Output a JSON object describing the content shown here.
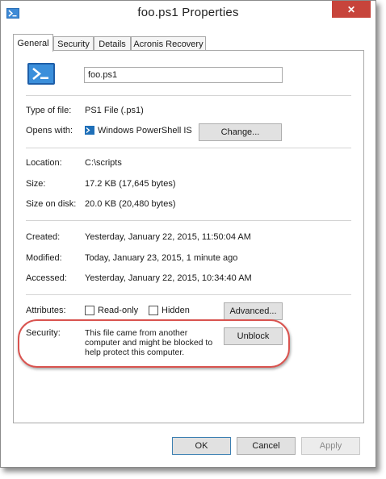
{
  "window": {
    "title": "foo.ps1 Properties",
    "close_glyph": "✕"
  },
  "tabs": [
    {
      "label": "General",
      "active": true
    },
    {
      "label": "Security",
      "active": false
    },
    {
      "label": "Details",
      "active": false
    },
    {
      "label": "Acronis Recovery",
      "active": false
    }
  ],
  "general": {
    "filename": "foo.ps1",
    "type_label": "Type of file:",
    "type_value": "PS1 File (.ps1)",
    "opens_label": "Opens with:",
    "opens_value": "Windows PowerShell IS",
    "change_button": "Change...",
    "location_label": "Location:",
    "location_value": "C:\\scripts",
    "size_label": "Size:",
    "size_value": "17.2 KB (17,645 bytes)",
    "size_disk_label": "Size on disk:",
    "size_disk_value": "20.0 KB (20,480 bytes)",
    "created_label": "Created:",
    "created_value": "Yesterday, January 22, 2015, 11:50:04 AM",
    "modified_label": "Modified:",
    "modified_value": "Today, January 23, 2015, 1 minute ago",
    "accessed_label": "Accessed:",
    "accessed_value": "Yesterday, January 22, 2015, 10:34:40 AM",
    "attributes_label": "Attributes:",
    "readonly_label": "Read-only",
    "hidden_label": "Hidden",
    "advanced_button": "Advanced...",
    "security_label": "Security:",
    "security_text_line1": "This file came from another",
    "security_text_line2": "computer and might be blocked to",
    "security_text_line3": "help protect this computer.",
    "unblock_button": "Unblock"
  },
  "footer": {
    "ok": "OK",
    "cancel": "Cancel",
    "apply": "Apply"
  },
  "colors": {
    "highlight": "#d9534f",
    "close": "#c7443b",
    "ps_icon": "#1e6fb8"
  }
}
